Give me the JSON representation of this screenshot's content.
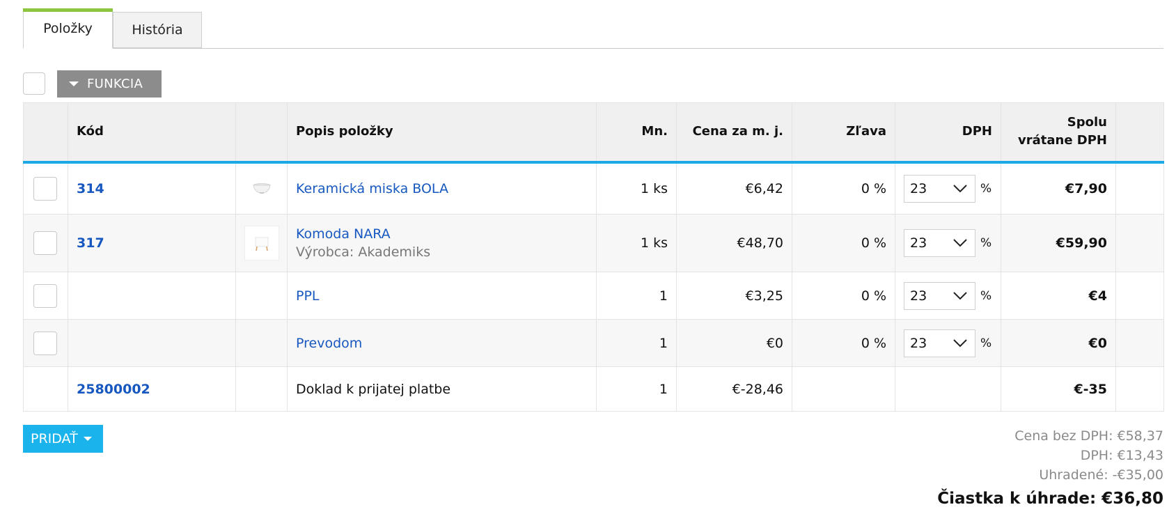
{
  "tabs": [
    {
      "label": "Položky",
      "active": true
    },
    {
      "label": "História",
      "active": false
    }
  ],
  "toolbar": {
    "function_label": "FUNKCIA"
  },
  "table": {
    "headers": {
      "kod": "Kód",
      "img": "",
      "popis": "Popis položky",
      "mn": "Mn.",
      "cena": "Cena za m. j.",
      "zlava": "Zľava",
      "dph": "DPH",
      "spolu": "Spolu vrátane DPH"
    },
    "rows": [
      {
        "code": "314",
        "name": "Keramická miska BOLA",
        "sub": "",
        "qty": "1 ks",
        "price": "€6,42",
        "discount": "0 %",
        "vat": "23",
        "vat_unit": "%",
        "total": "€7,90"
      },
      {
        "code": "317",
        "name": "Komoda NARA",
        "sub": "Výrobca: Akademiks",
        "qty": "1 ks",
        "price": "€48,70",
        "discount": "0 %",
        "vat": "23",
        "vat_unit": "%",
        "total": "€59,90"
      },
      {
        "code": "",
        "name": "PPL",
        "sub": "",
        "qty": "1",
        "price": "€3,25",
        "discount": "0 %",
        "vat": "23",
        "vat_unit": "%",
        "total": "€4"
      },
      {
        "code": "",
        "name": "Prevodom",
        "sub": "",
        "qty": "1",
        "price": "€0",
        "discount": "0 %",
        "vat": "23",
        "vat_unit": "%",
        "total": "€0"
      },
      {
        "code": "25800002",
        "name": "Doklad k prijatej platbe",
        "sub": "",
        "qty": "1",
        "price": "€-28,46",
        "discount": "",
        "vat": "",
        "vat_unit": "",
        "total": "€-35"
      }
    ]
  },
  "add_button": {
    "label": "PRIDAŤ"
  },
  "summary": {
    "without_vat": "Cena bez DPH: €58,37",
    "vat": "DPH: €13,43",
    "paid": "Uhradené: -€35,00",
    "to_pay": "Čiastka k úhrade: €36,80"
  },
  "colors": {
    "accent_tab": "#8cc63f",
    "header_line": "#1ba8e6",
    "link": "#1758c0",
    "add_button": "#1ab3ec",
    "function_button": "#8c8c8c"
  }
}
